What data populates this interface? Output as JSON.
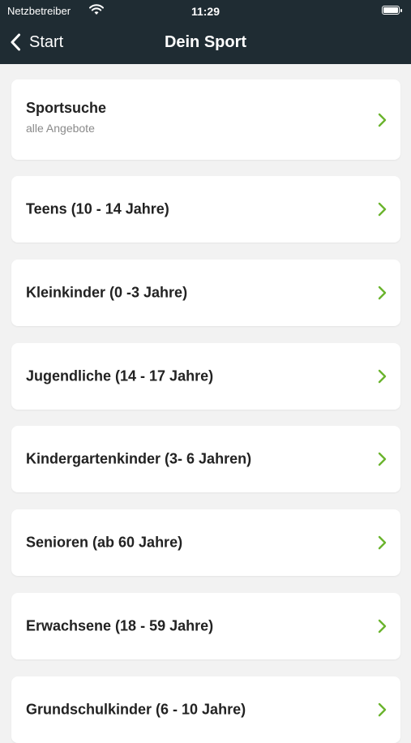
{
  "status_bar": {
    "carrier": "Netzbetreiber",
    "time": "11:29"
  },
  "nav": {
    "back_label": "Start",
    "title": "Dein Sport"
  },
  "colors": {
    "header_bg": "#1f2c33",
    "accent_chevron": "#6ab42d",
    "page_bg": "#f2f2f2"
  },
  "icons": {
    "back": "chevron-left-icon",
    "row": "chevron-right-icon",
    "wifi": "wifi-icon",
    "battery": "battery-icon"
  },
  "items": [
    {
      "label": "Sportsuche",
      "sublabel": "alle Angebote"
    },
    {
      "label": "Teens (10 - 14 Jahre)"
    },
    {
      "label": "Kleinkinder (0 -3 Jahre)"
    },
    {
      "label": "Jugendliche (14 - 17 Jahre)"
    },
    {
      "label": "Kindergartenkinder (3- 6 Jahren)"
    },
    {
      "label": "Senioren (ab 60 Jahre)"
    },
    {
      "label": "Erwachsene (18 - 59 Jahre)"
    },
    {
      "label": "Grundschulkinder (6 - 10 Jahre)"
    }
  ]
}
